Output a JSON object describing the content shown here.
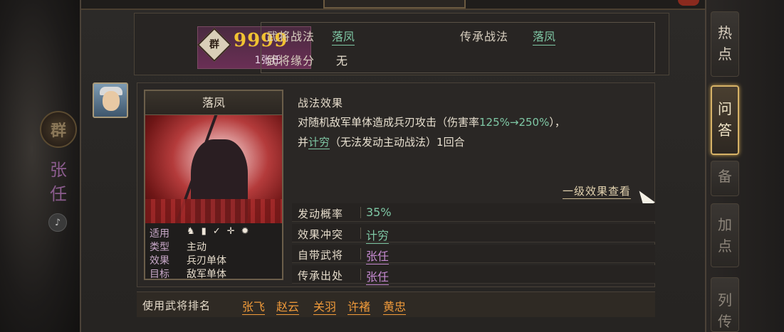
{
  "left_panel": {
    "faction": "群",
    "hero_name": "张任",
    "sound_icon": "speaker-icon"
  },
  "hero_card": {
    "faction": "群",
    "stars": "9999",
    "name": "1张任"
  },
  "skills": {
    "hero_skill_label": "武将战法",
    "hero_skill_value": "落凤",
    "inherit_skill_label": "传承战法",
    "inherit_skill_value": "落凤",
    "fate_label": "武将缘分",
    "fate_value": "无"
  },
  "skill_card": {
    "title": "落凤",
    "suit_label": "适用",
    "suit_icons": [
      "cavalry-icon",
      "shield-icon",
      "bow-icon",
      "spear-icon",
      "wheel-icon"
    ],
    "type_label": "类型",
    "type_value": "主动",
    "effect_label": "效果",
    "effect_value": "兵刃单体",
    "target_label": "目标",
    "target_value": "敌军单体"
  },
  "effect": {
    "title": "战法效果",
    "line1_prefix": "对随机敌军单体造成兵刃攻击（伤害率",
    "line1_rate": "125%→250%",
    "line1_suffix": "），",
    "line2_prefix": "并",
    "line2_link": "计穷",
    "line2_suffix": "（无法发动主动战法）1回合",
    "level_link": "一级效果查看"
  },
  "info_rows": [
    {
      "label": "发动概率",
      "value": "35%"
    },
    {
      "label": "效果冲突",
      "value": "计穷"
    },
    {
      "label": "自带武将",
      "value": "张任"
    },
    {
      "label": "传承出处",
      "value": "张任"
    }
  ],
  "ranking": {
    "label": "使用武将排名",
    "names": [
      "张飞",
      "赵云",
      "关羽",
      "许褚",
      "黄忠"
    ]
  },
  "right_tabs": [
    "热点",
    "问答",
    "备",
    "加点",
    "列传"
  ],
  "colors": {
    "link_green": "#7fc8a5",
    "hero_purple": "#c58ad0",
    "rank_orange": "#f09a3a",
    "active_tab_gold": "#d6b267"
  }
}
